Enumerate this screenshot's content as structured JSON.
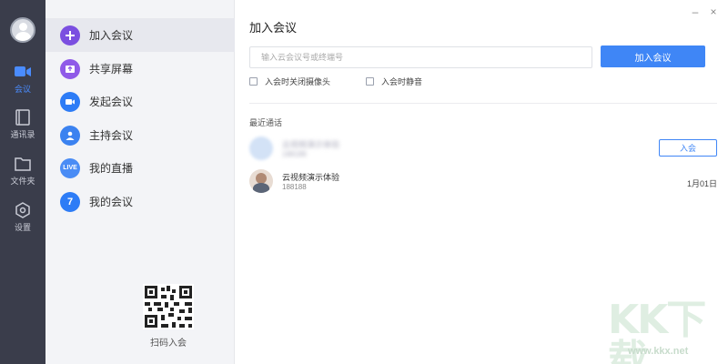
{
  "rail": {
    "items": [
      {
        "label": "会议",
        "icon": "video-camera-icon"
      },
      {
        "label": "通讯录",
        "icon": "contacts-icon"
      },
      {
        "label": "文件夹",
        "icon": "folder-icon"
      },
      {
        "label": "设置",
        "icon": "settings-icon"
      }
    ]
  },
  "menu": {
    "items": [
      {
        "label": "加入会议",
        "icon": "plus-icon"
      },
      {
        "label": "共享屏幕",
        "icon": "share-screen-icon"
      },
      {
        "label": "发起会议",
        "icon": "video-icon"
      },
      {
        "label": "主持会议",
        "icon": "host-icon"
      },
      {
        "label": "我的直播",
        "icon": "live-icon",
        "icon_text": "LIVE"
      },
      {
        "label": "我的会议",
        "icon": "calendar-icon",
        "icon_text": "7"
      }
    ],
    "qr_label": "扫码入会"
  },
  "content": {
    "title": "加入会议",
    "meeting_input": {
      "value": "",
      "placeholder": "输入云会议号或终端号"
    },
    "join_button": "加入会议",
    "options": [
      {
        "label": "入会时关闭摄像头",
        "checked": false
      },
      {
        "label": "入会时静音",
        "checked": false
      }
    ],
    "recent_title": "最近通话",
    "recent": [
      {
        "name": "云视频演示体验",
        "sub": "188188",
        "action": "入会"
      },
      {
        "name": "云视频演示体验",
        "sub": "188188",
        "date": "1月01日"
      }
    ]
  },
  "window": {
    "minimize": "–",
    "close": "×"
  },
  "watermark": {
    "big": "KK下载",
    "url": "www.kkx.net"
  },
  "colors": {
    "accent": "#3f86f6",
    "rail_bg": "#3a3d4b",
    "menu_bg": "#f3f4f7"
  }
}
